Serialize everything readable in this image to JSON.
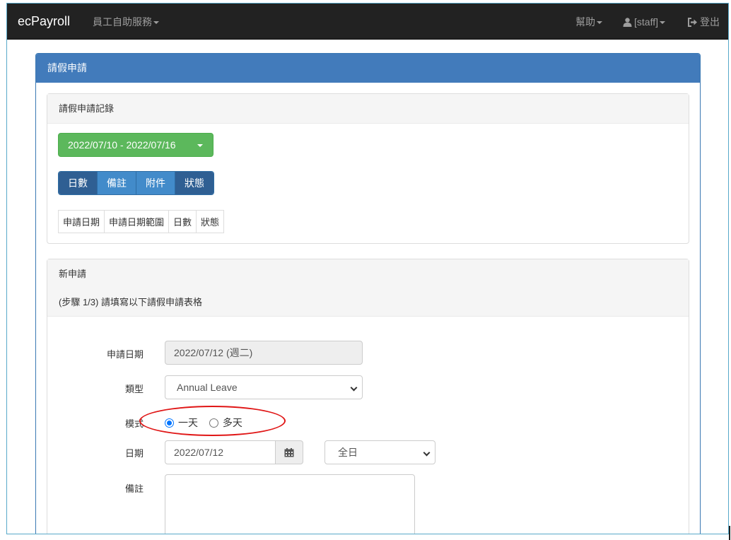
{
  "navbar": {
    "brand": "ecPayroll",
    "menu_self_service": "員工自助服務",
    "menu_help": "幫助",
    "menu_user": "[staff]",
    "menu_logout": "登出"
  },
  "panel": {
    "title": "請假申請"
  },
  "records": {
    "title": "請假申請記錄",
    "date_range": "2022/07/10 - 2022/07/16",
    "toggle_buttons": [
      "日數",
      "備註",
      "附件",
      "狀態"
    ],
    "table_headers": [
      "申請日期",
      "申請日期範圍",
      "日數",
      "狀態"
    ]
  },
  "new_request": {
    "title": "新申請",
    "step_text": "(步驟 1/3) 請填寫以下請假申請表格",
    "fields": {
      "apply_date_label": "申請日期",
      "apply_date_value": "2022/07/12 (週二)",
      "type_label": "類型",
      "type_value": "Annual Leave",
      "mode_label": "模式",
      "mode_option_one": "一天",
      "mode_option_multi": "多天",
      "date_label": "日期",
      "date_value": "2022/07/12",
      "period_value": "全日",
      "remark_label": "備註",
      "remark_value": ""
    }
  },
  "colors": {
    "navbar": "#222222",
    "panel_header": "#427bbb",
    "date_button": "#5cb85c",
    "group_dark": "#2f5f93",
    "group_light": "#428bca",
    "highlight_oval": "#e01616"
  }
}
